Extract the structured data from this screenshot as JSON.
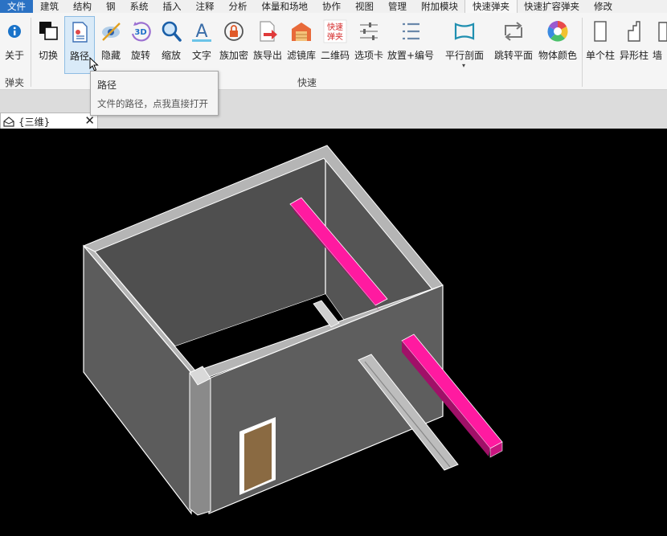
{
  "menu_tabs": [
    {
      "label": "文件",
      "state": "file"
    },
    {
      "label": "建筑",
      "state": ""
    },
    {
      "label": "结构",
      "state": ""
    },
    {
      "label": "钢",
      "state": ""
    },
    {
      "label": "系统",
      "state": ""
    },
    {
      "label": "插入",
      "state": ""
    },
    {
      "label": "注释",
      "state": ""
    },
    {
      "label": "分析",
      "state": ""
    },
    {
      "label": "体量和场地",
      "state": ""
    },
    {
      "label": "协作",
      "state": ""
    },
    {
      "label": "视图",
      "state": ""
    },
    {
      "label": "管理",
      "state": ""
    },
    {
      "label": "附加模块",
      "state": ""
    },
    {
      "label": "快速弹夹",
      "state": "active"
    },
    {
      "label": "快速扩容弹夹",
      "state": ""
    },
    {
      "label": "修改",
      "state": ""
    }
  ],
  "ribbon": {
    "buttons": [
      {
        "label": "关于",
        "icon": "info-icon"
      },
      {
        "label": "切换",
        "icon": "switch-icon"
      },
      {
        "label": "路径",
        "icon": "path-icon"
      },
      {
        "label": "隐藏",
        "icon": "hide-icon"
      },
      {
        "label": "旋转",
        "icon": "rotate-3d-icon",
        "icon_text": "3D"
      },
      {
        "label": "缩放",
        "icon": "zoom-icon"
      },
      {
        "label": "文字",
        "icon": "text-icon",
        "icon_text": "A"
      },
      {
        "label": "族加密",
        "icon": "family-encrypt-icon"
      },
      {
        "label": "族导出",
        "icon": "family-export-icon"
      },
      {
        "label": "滤镜库",
        "icon": "filter-library-icon"
      },
      {
        "label": "二维码",
        "icon": "qr-code-icon",
        "icon_text_1": "快速",
        "icon_text_2": "弹夹"
      },
      {
        "label": "选项卡",
        "icon": "option-tab-icon"
      },
      {
        "label": "放置+编号",
        "icon": "place-number-icon"
      },
      {
        "label": "平行剖面",
        "icon": "parallel-section-icon"
      },
      {
        "label": "跳转平面",
        "icon": "jump-plan-icon"
      },
      {
        "label": "物体颜色",
        "icon": "object-color-icon"
      },
      {
        "label": "单个柱",
        "icon": "single-column-icon"
      },
      {
        "label": "异形柱",
        "icon": "special-column-icon"
      },
      {
        "label": "墙",
        "icon": "wall-icon"
      }
    ],
    "groups": [
      {
        "label": "弹夹"
      },
      {
        "label": "快速"
      }
    ]
  },
  "tooltip": {
    "title": "路径",
    "description": "文件的路径，点我直接打开"
  },
  "doc_tab": {
    "title": "{三维}",
    "close": "✕"
  },
  "colors": {
    "background": "#000000",
    "wall_side": "#5a5a5a",
    "beam": "#ff1aa0",
    "door": "#8a6a42",
    "accent": "#2b72c4"
  }
}
